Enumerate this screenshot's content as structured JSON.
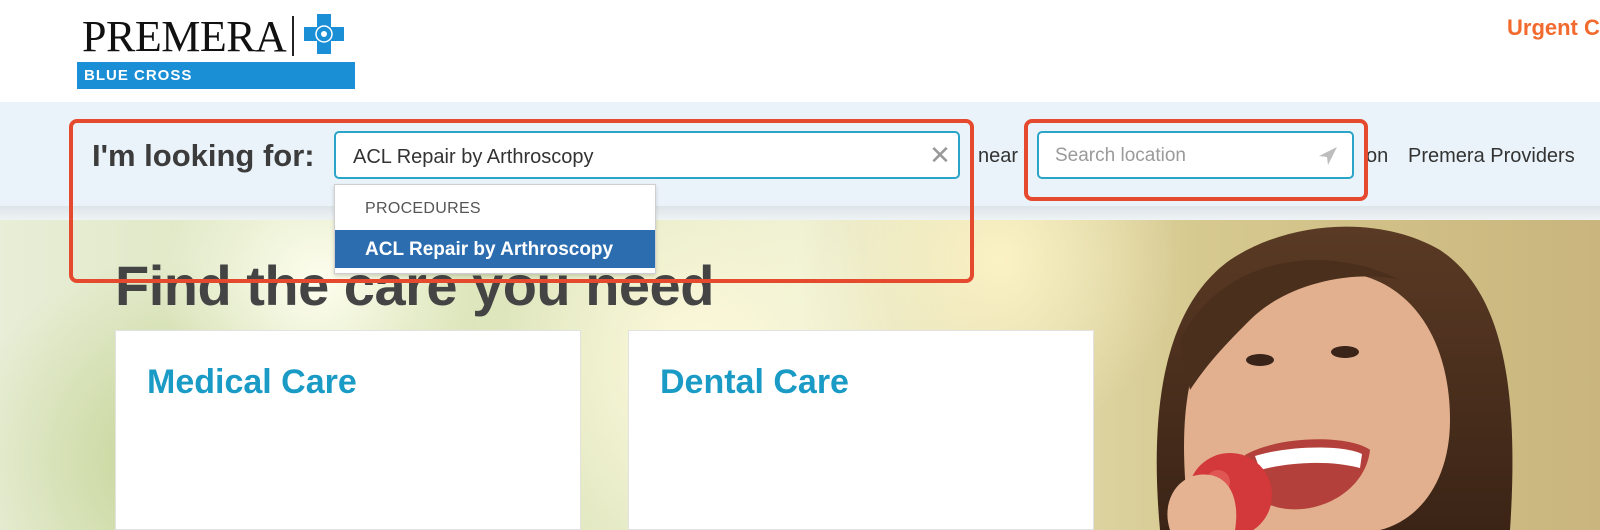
{
  "header": {
    "logo_word": "PREMERA",
    "logo_tagline": "BLUE CROSS",
    "urgent_link": "Urgent Ca"
  },
  "search": {
    "label": "I'm looking for:",
    "query_value": "ACL Repair by Arthroscopy",
    "near_label": "near",
    "location_placeholder": "Search location",
    "on_label": "on",
    "network_value": "Premera Providers"
  },
  "dropdown": {
    "group_heading": "PROCEDURES",
    "items": [
      "ACL Repair by Arthroscopy"
    ]
  },
  "hero": {
    "title": "Find the care you need",
    "cards": [
      {
        "title": "Medical Care"
      },
      {
        "title": "Dental Care"
      }
    ]
  },
  "colors": {
    "accent_blue": "#1a9bc6",
    "brand_blue": "#1a8fd6",
    "highlight_red": "#e64a2e",
    "urgent_orange": "#f26a2e",
    "dropdown_selected": "#2c6db0"
  },
  "icons": {
    "clear": "close-icon",
    "location": "location-arrow-icon",
    "brand": "blue-cross-icon"
  }
}
